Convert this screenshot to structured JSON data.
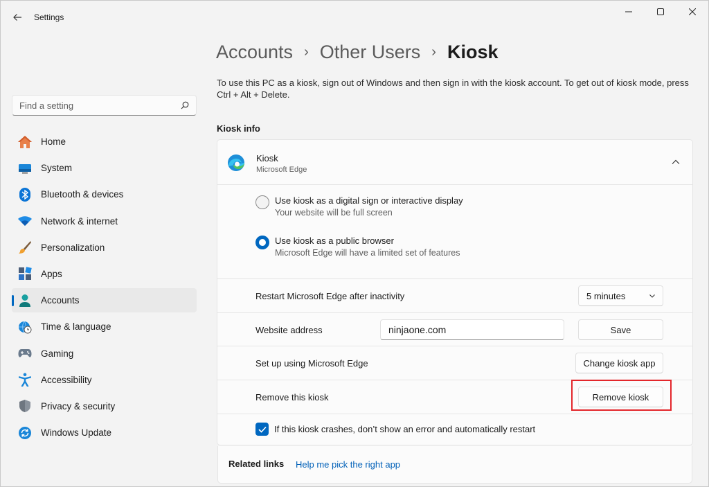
{
  "window": {
    "app_title": "Settings",
    "controls": [
      "minimize-icon",
      "maximize-icon",
      "close-icon"
    ]
  },
  "search": {
    "placeholder": "Find a setting",
    "value": ""
  },
  "sidebar": {
    "items": [
      {
        "label": "Home",
        "icon": "home-icon"
      },
      {
        "label": "System",
        "icon": "monitor-icon"
      },
      {
        "label": "Bluetooth & devices",
        "icon": "bluetooth-icon"
      },
      {
        "label": "Network & internet",
        "icon": "wifi-icon"
      },
      {
        "label": "Personalization",
        "icon": "brush-icon"
      },
      {
        "label": "Apps",
        "icon": "apps-icon"
      },
      {
        "label": "Accounts",
        "icon": "person-icon",
        "active": true
      },
      {
        "label": "Time & language",
        "icon": "globe-clock-icon"
      },
      {
        "label": "Gaming",
        "icon": "gamepad-icon"
      },
      {
        "label": "Accessibility",
        "icon": "accessibility-icon"
      },
      {
        "label": "Privacy & security",
        "icon": "shield-icon"
      },
      {
        "label": "Windows Update",
        "icon": "update-icon"
      }
    ]
  },
  "breadcrumb": {
    "items": [
      "Accounts",
      "Other Users"
    ],
    "current": "Kiosk",
    "separator": "›"
  },
  "description": "To use this PC as a kiosk, sign out of Windows and then sign in with the kiosk account. To get out of kiosk mode, press Ctrl + Alt + Delete.",
  "kiosk_info": {
    "section_title": "Kiosk info",
    "card": {
      "title": "Kiosk",
      "subtitle": "Microsoft Edge",
      "options": [
        {
          "label": "Use kiosk as a digital sign or interactive display",
          "sub": "Your website will be full screen",
          "checked": false
        },
        {
          "label": "Use kiosk as a public browser",
          "sub": "Microsoft Edge will have a limited set of features",
          "checked": true
        }
      ],
      "restart_label": "Restart Microsoft Edge after inactivity",
      "restart_value": "5 minutes",
      "website_label": "Website address",
      "website_value": "ninjaone.com",
      "save_label": "Save",
      "setup_label": "Set up using Microsoft Edge",
      "change_app_label": "Change kiosk app",
      "remove_label": "Remove this kiosk",
      "remove_button": "Remove kiosk",
      "crash_label": "If this kiosk crashes, don’t show an error and automatically restart",
      "crash_checked": true
    }
  },
  "related": {
    "label": "Related links",
    "link": "Help me pick the right app"
  },
  "colors": {
    "accent": "#0067c0",
    "highlight": "#e3262b",
    "link": "#0060b8"
  }
}
